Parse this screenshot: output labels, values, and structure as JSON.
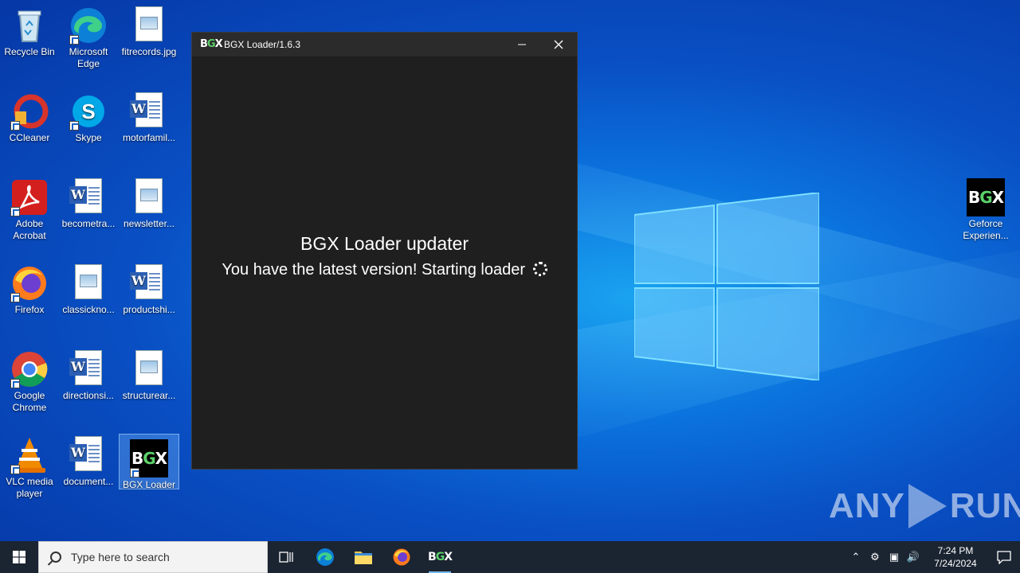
{
  "desktop": {
    "icons_col1": [
      {
        "label": "Recycle Bin",
        "icon": "recycle-bin-icon"
      },
      {
        "label": "CCleaner",
        "icon": "ccleaner-icon"
      },
      {
        "label": "Adobe Acrobat",
        "icon": "adobe-acrobat-icon"
      },
      {
        "label": "Firefox",
        "icon": "firefox-icon"
      },
      {
        "label": "Google Chrome",
        "icon": "chrome-icon"
      },
      {
        "label": "VLC media player",
        "icon": "vlc-icon"
      }
    ],
    "icons_col2": [
      {
        "label": "Microsoft Edge",
        "icon": "edge-icon"
      },
      {
        "label": "Skype",
        "icon": "skype-icon"
      },
      {
        "label": "becometra...",
        "icon": "word-doc-icon"
      },
      {
        "label": "classickno...",
        "icon": "image-file-icon"
      },
      {
        "label": "directionsi...",
        "icon": "word-doc-icon"
      },
      {
        "label": "document...",
        "icon": "word-doc-icon"
      }
    ],
    "icons_col3": [
      {
        "label": "fitrecords.jpg",
        "icon": "image-file-icon"
      },
      {
        "label": "motorfamil...",
        "icon": "word-doc-icon"
      },
      {
        "label": "newsletter...",
        "icon": "image-file-icon"
      },
      {
        "label": "productshi...",
        "icon": "word-doc-icon"
      },
      {
        "label": "structurear...",
        "icon": "image-file-icon"
      },
      {
        "label": "BGX Loader",
        "icon": "bgx-loader-icon"
      }
    ],
    "icon_right": {
      "label": "Geforce Experien...",
      "icon": "bgx-loader-icon"
    },
    "watermark_left": "ANY",
    "watermark_right": "RUN"
  },
  "app_window": {
    "title": "BGX Loader/1.6.3",
    "logo_text_a": "B",
    "logo_text_b": "G",
    "logo_text_c": "X",
    "heading": "BGX Loader updater",
    "message": "You have the latest version! Starting loader"
  },
  "taskbar": {
    "search_placeholder": "Type here to search",
    "time": "7:24 PM",
    "date": "7/24/2024",
    "bgx_label": "BGX"
  },
  "colors": {
    "accent_green": "#5cd16a",
    "window_bg": "#1f1f1f",
    "taskbar_bg": "#1b2431"
  }
}
